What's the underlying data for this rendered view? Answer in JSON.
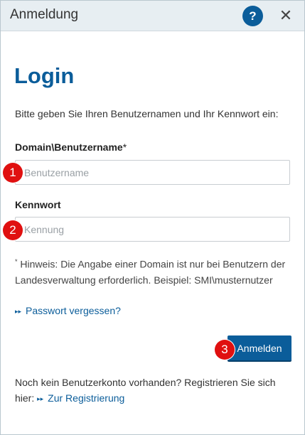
{
  "dialog": {
    "title": "Anmeldung",
    "help_icon": "question-mark-icon",
    "help_label": "?",
    "close_icon": "close-icon",
    "close_label": "✕"
  },
  "login": {
    "heading": "Login",
    "intro": "Bitte geben Sie Ihren Benutzernamen und Ihr Kennwort ein:",
    "username_label": "Domain\\Benutzername",
    "username_asterisk": "*",
    "username_placeholder": "Benutzername",
    "password_label": "Kennwort",
    "password_placeholder": "Kennung",
    "hint_asterisk": "*",
    "hint": "Hinweis: Die Angabe einer Domain ist nur bei Benutzern der Landesverwaltung erforderlich. Beispiel: SMI\\musternutzer",
    "forgot_link": "Passwort vergessen?",
    "submit": "Anmelden",
    "no_account": "Noch kein Benutzerkonto vorhanden? Registrieren Sie sich hier:",
    "register_link": "Zur Registrierung"
  },
  "markers": [
    "1",
    "2",
    "3"
  ],
  "colors": {
    "accent": "#0b5d9a",
    "marker": "#e01010"
  }
}
